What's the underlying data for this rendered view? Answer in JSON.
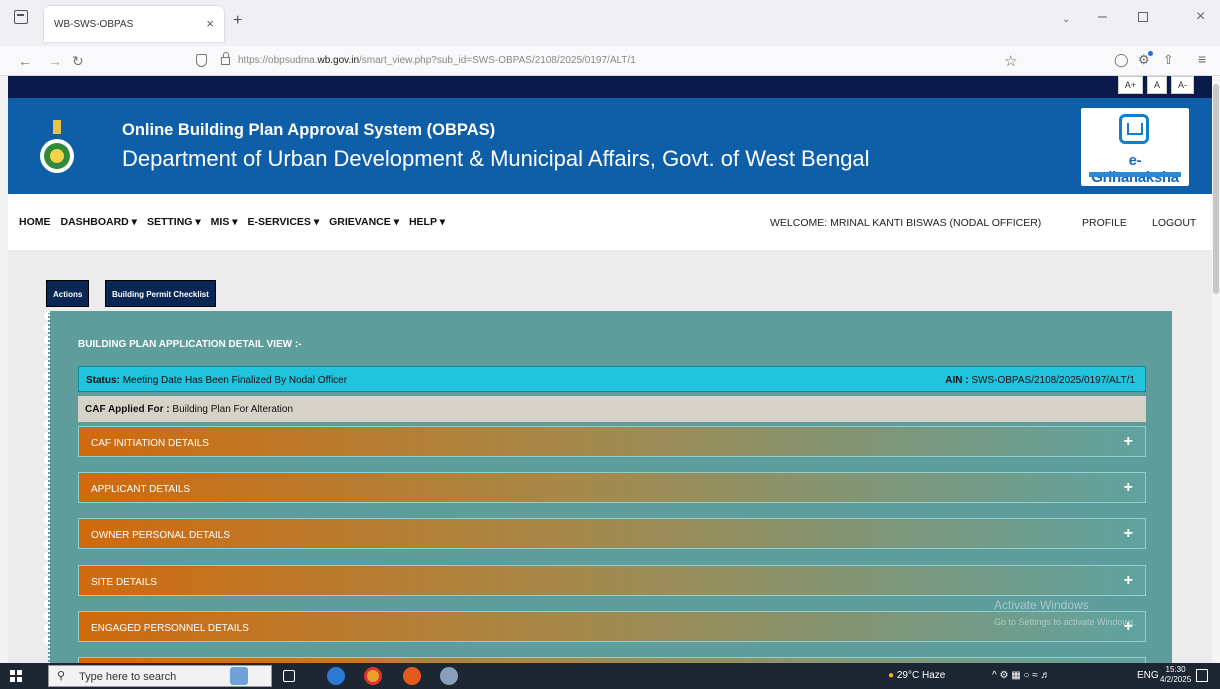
{
  "browser": {
    "tab_title": "WB-SWS-OBPAS",
    "tab_close": "×",
    "new_tab": "+",
    "url_prefix": "https://obpsudma.",
    "url_domain": "wb.gov.in",
    "url_suffix": "/smart_view.php?sub_id=SWS-OBPAS/2108/2025/0197/ALT/1"
  },
  "page": {
    "font_buttons": [
      "A+",
      "A",
      "A-"
    ],
    "header": {
      "title": "Online Building Plan Approval System (OBPAS)",
      "subtitle": "Department of Urban Development & Municipal Affairs, Govt. of West Bengal",
      "logo_text": "e-Grihanaksha"
    },
    "menu": {
      "items": [
        "HOME",
        "DASHBOARD ▾",
        "SETTING ▾",
        "MIS ▾",
        "E-SERVICES ▾",
        "GRIEVANCE ▾",
        "HELP ▾"
      ],
      "welcome": "WELCOME: MRINAL KANTI BISWAS (NODAL OFFICER)",
      "profile": "PROFILE",
      "logout": "LOGOUT"
    },
    "buttons": {
      "actions": "Actions",
      "checklist": "Building Permit Checklist"
    },
    "detail": {
      "title": "BUILDING PLAN APPLICATION DETAIL VIEW :-",
      "status_label": "Status:",
      "status_value": "Meeting Date Has Been Finalized By Nodal Officer",
      "ain_label": "AIN :",
      "ain_value": "SWS-OBPAS/2108/2025/0197/ALT/1",
      "caf_label": "CAF Applied For :",
      "caf_value": "Building Plan For Alteration",
      "sections": [
        "CAF INITIATION DETAILS",
        "APPLICANT DETAILS",
        "OWNER PERSONAL DETAILS",
        "SITE DETAILS",
        "ENGAGED PERSONNEL DETAILS"
      ]
    },
    "watermark": {
      "line1": "Activate Windows",
      "line2": "Go to Settings to activate Windows."
    }
  },
  "taskbar": {
    "search_placeholder": "Type here to search",
    "weather": "29°C Haze",
    "lang": "ENG",
    "time": "15:30",
    "date": "4/2/2025"
  },
  "colors": {
    "banner": "#0f5fa8",
    "panel": "#5f9c9c",
    "status": "#22c3dd",
    "accordion_start": "#d06a0d"
  }
}
